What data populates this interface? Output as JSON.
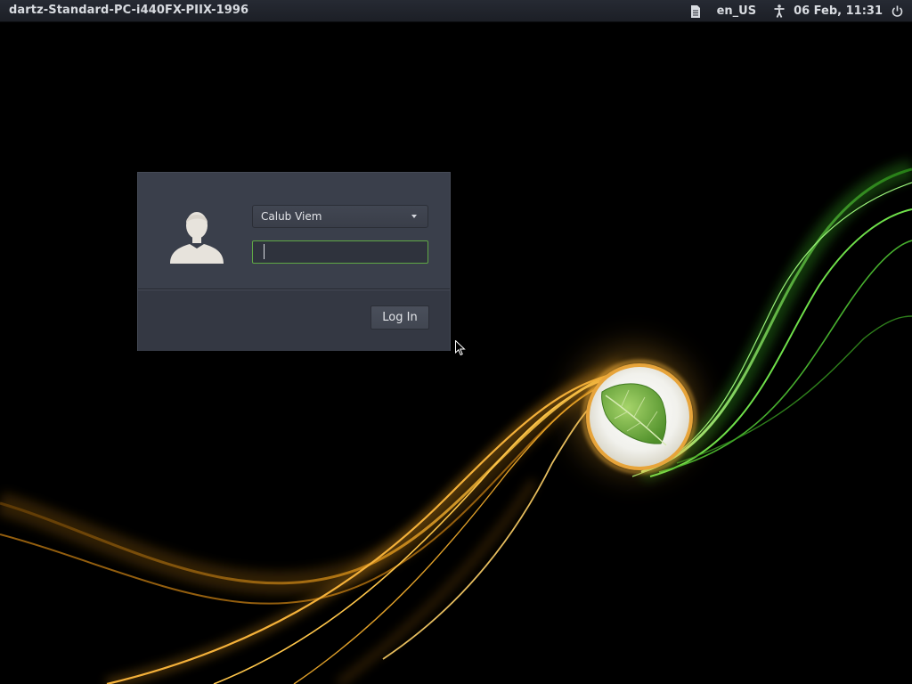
{
  "top_panel": {
    "hostname": "dartz-Standard-PC-i440FX-PIIX-1996",
    "keyboard_layout": "en_US",
    "datetime": "06 Feb, 11:31",
    "icons": [
      "document-icon",
      "accessibility-icon",
      "power-icon"
    ]
  },
  "login": {
    "selected_user": "Calub Viem",
    "password_value": "",
    "login_button_label": "Log In"
  },
  "colors": {
    "panel_bg": "#1c1f26",
    "dialog_bg": "#3a3f4b",
    "focus_border": "#5fa845",
    "wallpaper_gold": "#f2a81c",
    "wallpaper_green": "#5fd33a"
  },
  "wallpaper": {
    "theme": "dark background with golden and green light swooshes and a circular leaf emblem"
  }
}
